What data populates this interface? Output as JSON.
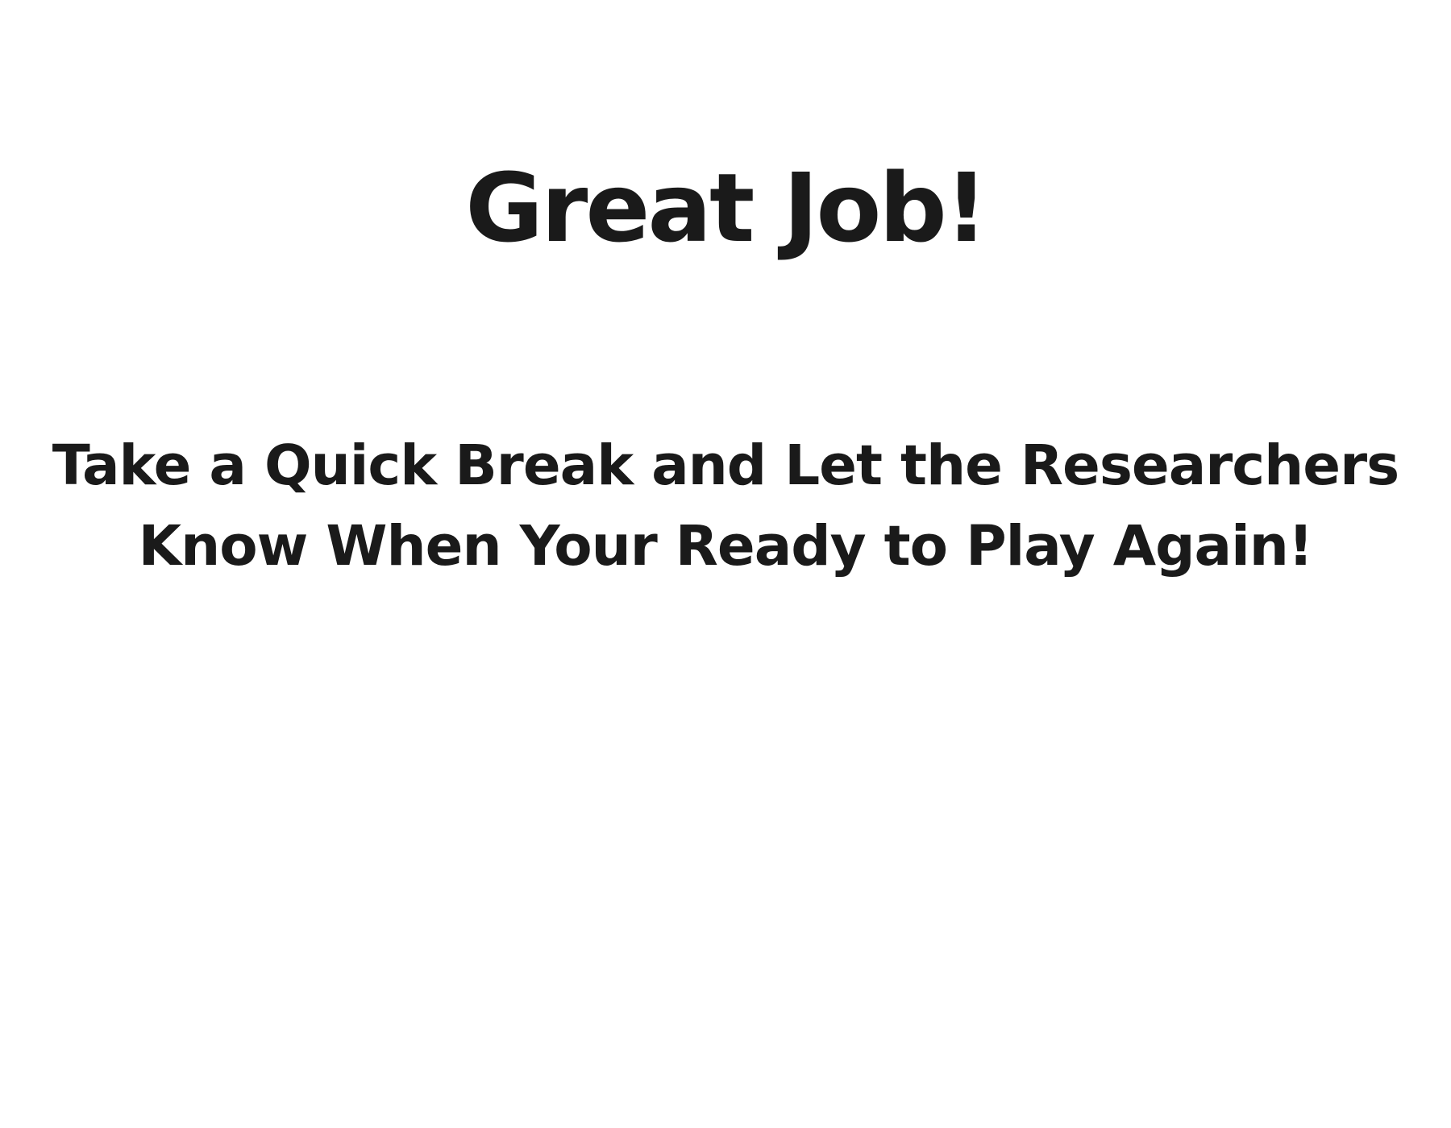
{
  "heading": "Great Job!",
  "message": {
    "line1": "Take a Quick Break and Let the Researchers",
    "line2": "Know When Your Ready to Play Again!"
  }
}
